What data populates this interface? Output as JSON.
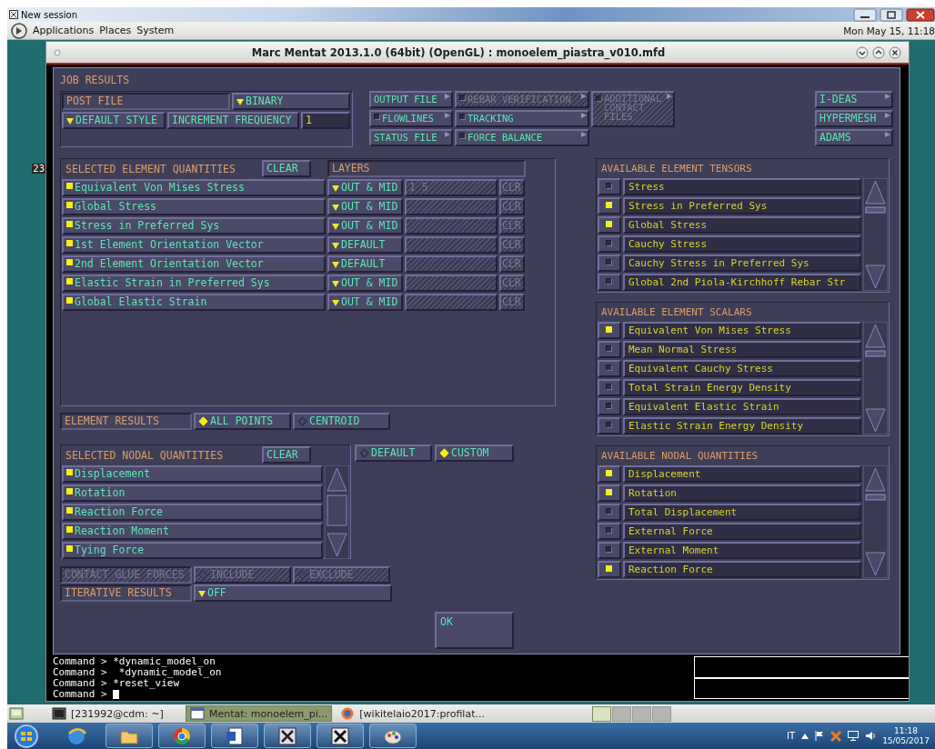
{
  "desktop": {
    "session_title": "New session",
    "panel_menus": [
      "Applications",
      "Places",
      "System"
    ],
    "clock": "Mon May 15, 11:18",
    "behind_window_text": "23"
  },
  "window": {
    "title": "Marc Mentat 2013.1.0 (64bit) (OpenGL) : monoelem_piastra_v010.mfd"
  },
  "dialog": {
    "title": "JOB RESULTS",
    "post_file": {
      "label": "POST FILE",
      "format": "BINARY",
      "style": "DEFAULT STYLE",
      "increment_label": "INCREMENT FREQUENCY",
      "increment_value": "1"
    },
    "file_buttons": [
      {
        "label": "OUTPUT FILE",
        "kind": "button",
        "disabled": false
      },
      {
        "label": "FLOWLINES",
        "kind": "toggle",
        "checked": false,
        "disabled": false
      },
      {
        "label": "STATUS FILE",
        "kind": "button",
        "disabled": false
      },
      {
        "label": "REBAR VERIFICATION",
        "kind": "toggle",
        "checked": false,
        "disabled": true
      },
      {
        "label": "TRACKING",
        "kind": "toggle",
        "checked": false,
        "disabled": false
      },
      {
        "label": "FORCE BALANCE",
        "kind": "toggle",
        "checked": false,
        "disabled": false
      },
      {
        "label": "ADDITIONAL CONTACT FILES",
        "kind": "toggle",
        "checked": false,
        "disabled": true
      }
    ],
    "export_buttons": [
      "I-DEAS",
      "HYPERMESH",
      "ADAMS"
    ],
    "element_quantities": {
      "title": "SELECTED ELEMENT QUANTITIES",
      "clear": "CLEAR",
      "layers_title": "LAYERS",
      "rows": [
        {
          "name": "Equivalent Von Mises Stress",
          "checked": true,
          "layer": "OUT & MID",
          "layer_list": "1 5",
          "clr": "CLR",
          "layer_disabled": true
        },
        {
          "name": "Global Stress",
          "checked": true,
          "layer": "OUT & MID",
          "clr": "CLR",
          "layer_disabled": true
        },
        {
          "name": "Stress in Preferred Sys",
          "checked": true,
          "layer": "OUT & MID",
          "clr": "CLR",
          "layer_disabled": true
        },
        {
          "name": "1st Element Orientation Vector",
          "checked": true,
          "layer": "DEFAULT",
          "clr": "CLR",
          "layer_disabled": true
        },
        {
          "name": "2nd Element Orientation Vector",
          "checked": true,
          "layer": "DEFAULT",
          "clr": "CLR",
          "layer_disabled": true
        },
        {
          "name": "Elastic Strain in Preferred Sys",
          "checked": true,
          "layer": "OUT & MID",
          "clr": "CLR",
          "layer_disabled": true
        },
        {
          "name": "Global Elastic Strain",
          "checked": true,
          "layer": "OUT & MID",
          "clr": "CLR",
          "layer_disabled": true
        }
      ]
    },
    "element_results": {
      "label": "ELEMENT RESULTS",
      "options": [
        {
          "label": "ALL POINTS",
          "selected": true
        },
        {
          "label": "CENTROID",
          "selected": false
        }
      ]
    },
    "nodal_quantities": {
      "title": "SELECTED NODAL QUANTITIES",
      "clear": "CLEAR",
      "items": [
        {
          "name": "Displacement",
          "checked": true
        },
        {
          "name": "Rotation",
          "checked": true
        },
        {
          "name": "Reaction Force",
          "checked": true
        },
        {
          "name": "Reaction Moment",
          "checked": true
        },
        {
          "name": "Tying Force",
          "checked": true
        }
      ],
      "modes": [
        {
          "label": "DEFAULT",
          "selected": false
        },
        {
          "label": "CUSTOM",
          "selected": true
        }
      ]
    },
    "contact_glue": {
      "label": "CONTACT GLUE FORCES",
      "disabled": true,
      "options": [
        {
          "label": "INCLUDE",
          "selected": false
        },
        {
          "label": "EXCLUDE",
          "selected": false
        }
      ]
    },
    "iterative": {
      "label": "ITERATIVE RESULTS",
      "value": "OFF"
    },
    "ok": "OK",
    "available": [
      {
        "title": "AVAILABLE ELEMENT TENSORS",
        "items": [
          {
            "name": "Stress",
            "checked": false
          },
          {
            "name": "Stress in Preferred Sys",
            "checked": true
          },
          {
            "name": "Global Stress",
            "checked": true
          },
          {
            "name": "Cauchy Stress",
            "checked": false
          },
          {
            "name": "Cauchy Stress in Preferred Sys",
            "checked": false
          },
          {
            "name": "Global 2nd Piola-Kirchhoff Rebar Str",
            "checked": false
          }
        ]
      },
      {
        "title": "AVAILABLE ELEMENT SCALARS",
        "items": [
          {
            "name": "Equivalent Von Mises Stress",
            "checked": true
          },
          {
            "name": "Mean Normal Stress",
            "checked": false
          },
          {
            "name": "Equivalent Cauchy Stress",
            "checked": false
          },
          {
            "name": "Total Strain Energy Density",
            "checked": false
          },
          {
            "name": "Equivalent Elastic Strain",
            "checked": false
          },
          {
            "name": "Elastic Strain Energy Density",
            "checked": false
          }
        ]
      },
      {
        "title": "AVAILABLE NODAL QUANTITIES",
        "items": [
          {
            "name": "Displacement",
            "checked": true
          },
          {
            "name": "Rotation",
            "checked": true
          },
          {
            "name": "Total Displacement",
            "checked": false
          },
          {
            "name": "External Force",
            "checked": false
          },
          {
            "name": "External Moment",
            "checked": false
          },
          {
            "name": "Reaction Force",
            "checked": true
          }
        ]
      }
    ]
  },
  "console": {
    "lines": [
      "Command > *dynamic_model_on",
      "Command >  *dynamic_model_on",
      "Command > *reset_view",
      "Command > "
    ]
  },
  "bottom_panel": {
    "tasks": [
      {
        "label": "[231992@cdm: ~]",
        "selected": false
      },
      {
        "label": "Mentat: monoelem_pi...",
        "selected": true
      },
      {
        "label": "[wikitelaio2017:profilat...",
        "selected": false
      }
    ],
    "workspaces": [
      {
        "selected": true
      },
      {
        "selected": false
      },
      {
        "selected": false
      },
      {
        "selected": false
      }
    ]
  },
  "taskbar": {
    "apps": [
      {
        "running": false
      },
      {
        "running": true
      },
      {
        "running": true
      },
      {
        "running": true
      },
      {
        "running": true
      },
      {
        "running": true
      },
      {
        "running": true
      }
    ],
    "language": "IT",
    "time": "11:18",
    "date": "15/05/2017"
  }
}
